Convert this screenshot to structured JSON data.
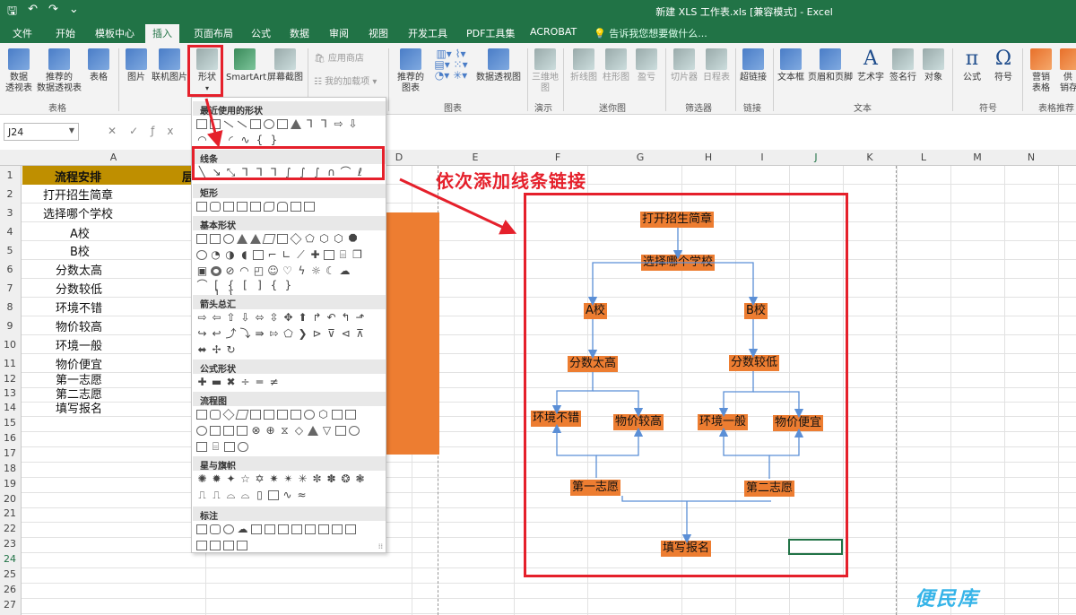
{
  "titlebar": {
    "title": "新建 XLS 工作表.xls  [兼容模式] - Excel"
  },
  "tabs": [
    "文件",
    "开始",
    "模板中心",
    "插入",
    "页面布局",
    "公式",
    "数据",
    "审阅",
    "视图",
    "开发工具",
    "PDF工具集",
    "ACROBAT"
  ],
  "active_tab": "插入",
  "tell_me": "告诉我您想要做什么...",
  "ribbon": {
    "buttons": [
      {
        "label": "数据\n透视表"
      },
      {
        "label": "推荐的\n数据透视表"
      },
      {
        "label": "表格"
      },
      {
        "label": "图片"
      },
      {
        "label": "联机图片"
      },
      {
        "label": "形状"
      },
      {
        "label": "SmartArt"
      },
      {
        "label": "屏幕截图"
      },
      {
        "label": "应用商店"
      },
      {
        "label": "我的加载项"
      },
      {
        "label": "推荐的\n图表"
      },
      {
        "label": "数据透视图"
      },
      {
        "label": "三维地\n图"
      },
      {
        "label": "折线图"
      },
      {
        "label": "柱形图"
      },
      {
        "label": "盈亏"
      },
      {
        "label": "切片器"
      },
      {
        "label": "日程表"
      },
      {
        "label": "超链接"
      },
      {
        "label": "文本框"
      },
      {
        "label": "页眉和页脚"
      },
      {
        "label": "艺术字"
      },
      {
        "label": "签名行"
      },
      {
        "label": "对象"
      },
      {
        "label": "公式"
      },
      {
        "label": "符号"
      },
      {
        "label": "营销\n表格"
      },
      {
        "label": "供\n销存"
      }
    ],
    "groups": [
      "表格",
      "图表",
      "演示",
      "迷你图",
      "筛选器",
      "链接",
      "文本",
      "符号",
      "表格推荐"
    ]
  },
  "formula_bar": {
    "name_box": "J24"
  },
  "columns": [
    "A",
    "D",
    "E",
    "F",
    "G",
    "H",
    "I",
    "J",
    "K",
    "L",
    "M",
    "N"
  ],
  "rows": [
    "1",
    "2",
    "3",
    "4",
    "5",
    "6",
    "7",
    "8",
    "9",
    "10",
    "11",
    "12",
    "13",
    "14",
    "15",
    "16",
    "17",
    "18",
    "19",
    "20",
    "21",
    "22",
    "23",
    "24",
    "25",
    "26",
    "27",
    "28"
  ],
  "sheet": {
    "a1": "流程安排",
    "b1_partial": "层",
    "cells": [
      "打开招生简章",
      "选择哪个学校",
      "A校",
      "B校",
      "分数太高",
      "分数较低",
      "环境不错",
      "物价较高",
      "环境一般",
      "物价便宜",
      "第一志愿",
      "第二志愿",
      "填写报名"
    ]
  },
  "shapes_panel": {
    "sections": [
      "最近使用的形状",
      "线条",
      "矩形",
      "基本形状",
      "箭头总汇",
      "公式形状",
      "流程图",
      "星与旗帜",
      "标注"
    ]
  },
  "annotation": "依次添加线条链接",
  "flowchart": {
    "nodes": {
      "open": "打开招生简章",
      "choose": "选择哪个学校",
      "a": "A校",
      "b": "B校",
      "high": "分数太高",
      "low": "分数较低",
      "env_good": "环境不错",
      "price_high": "物价较高",
      "env_ok": "环境一般",
      "price_low": "物价便宜",
      "first": "第一志愿",
      "second": "第二志愿",
      "fill": "填写报名"
    }
  },
  "watermark": "便民库",
  "colors": {
    "excel_green": "#217346",
    "orange": "#ed7d31",
    "gold": "#bf8f00",
    "red": "#e5202b",
    "line_blue": "#5b8fd6"
  }
}
